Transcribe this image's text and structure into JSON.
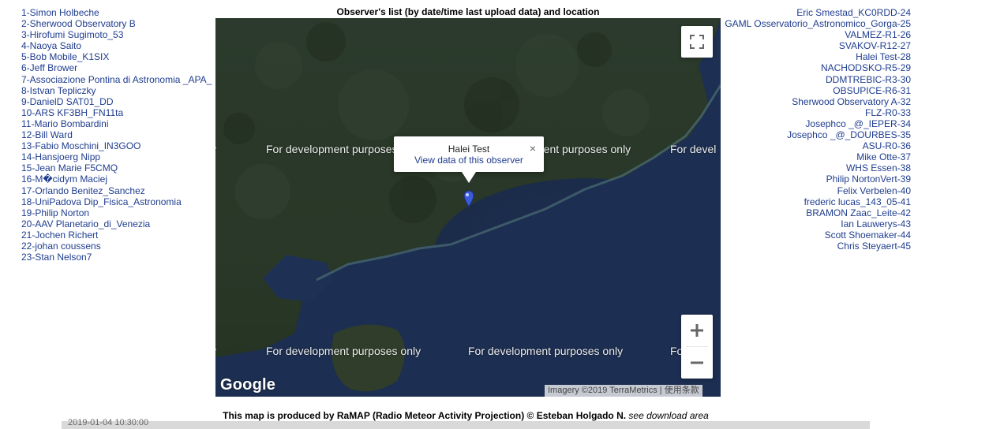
{
  "title": "Observer's list (by date/time last upload data) and location",
  "left_list": [
    "1-Simon Holbeche",
    "2-Sherwood Observatory B",
    "3-Hirofumi Sugimoto_53",
    "4-Naoya Saito",
    "5-Bob Mobile_K1SIX",
    "6-Jeff Brower",
    "7-Associazione Pontina di Astronomia _APA_",
    "8-Istvan Tepliczky",
    "9-DanielD SAT01_DD",
    "10-ARS KF3BH_FN11ta",
    "11-Mario Bombardini",
    "12-Bill Ward",
    "13-Fabio Moschini_IN3GOO",
    "14-Hansjoerg Nipp",
    "15-Jean Marie F5CMQ",
    "16-M�cidym Maciej",
    "17-Orlando Benitez_Sanchez",
    "18-UniPadova Dip_Fisica_Astronomia",
    "19-Philip Norton",
    "20-AAV Planetario_di_Venezia",
    "21-Jochen Richert",
    "22-johan coussens",
    "23-Stan Nelson7"
  ],
  "right_list": [
    "Eric Smestad_KC0RDD-24",
    "GAML Osservatorio_Astronomico_Gorga-25",
    "VALMEZ-R1-26",
    "SVAKOV-R12-27",
    "Halei Test-28",
    "NACHODSKO-R5-29",
    "DDMTREBIC-R3-30",
    "OBSUPICE-R6-31",
    "Sherwood Observatory A-32",
    "FLZ-R0-33",
    "Josephco _@_IEPER-34",
    "Josephco _@_DOURBES-35",
    "ASU-R0-36",
    "Mike Otte-37",
    "WHS Essen-38",
    "Philip NortonVert-39",
    "Felix Verbelen-40",
    "frederic lucas_143_05-41",
    "BRAMON Zaac_Leite-42",
    "Ian Lauwerys-43",
    "Scott Shoemaker-44",
    "Chris Steyaert-45"
  ],
  "map": {
    "watermark_top": [
      "For development purposes only",
      "ment purposes only",
      "For devel"
    ],
    "watermark_bottom": [
      "For development purposes only",
      "For development purposes only",
      "Fo"
    ],
    "popup": {
      "title": "Halei Test",
      "link": "View data of this observer",
      "close": "×"
    },
    "google_logo": "Google",
    "attribution": "Imagery ©2019 TerraMetrics | 使用条款",
    "icons": {
      "fullscreen": "fullscreen-icon",
      "zoom_in": "plus-icon",
      "zoom_out": "minus-icon",
      "marker": "map-pin-icon"
    }
  },
  "footer": {
    "bold": "This map is produced by RaMAP (Radio Meteor Activity Projection) © Esteban Holgado N.",
    "italic": "see download area"
  },
  "bottom_date": "2019-01-04 10:30:00"
}
